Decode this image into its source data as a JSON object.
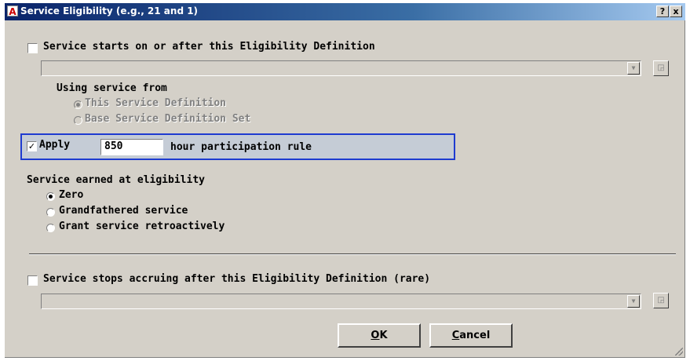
{
  "window": {
    "title": "Service Eligibility (e.g., 21 and 1)",
    "help_btn": "?",
    "close_btn": "x"
  },
  "service_start": {
    "label": "Service starts on or after this Eligibility Definition",
    "checked": false,
    "combo_value": "",
    "using_label": "Using service from",
    "radios": [
      {
        "label": "This Service Definition",
        "selected": true
      },
      {
        "label": "Base Service Definition Set",
        "selected": false
      }
    ]
  },
  "apply": {
    "checked": true,
    "check_mark": "✓",
    "label": "Apply",
    "hours_value": "850",
    "suffix": "hour participation rule"
  },
  "service_earned": {
    "label": "Service earned at eligibility",
    "options": [
      {
        "label": "Zero",
        "selected": true
      },
      {
        "label": "Grandfathered service",
        "selected": false
      },
      {
        "label": "Grant service retroactively",
        "selected": false
      }
    ]
  },
  "service_stop": {
    "label": "Service stops accruing after this Eligibility Definition (rare)",
    "checked": false,
    "combo_value": ""
  },
  "buttons": {
    "ok_accel": "O",
    "ok_rest": "K",
    "cancel_accel": "C",
    "cancel_rest": "ancel"
  },
  "colors": {
    "title_bar": "#0a246a",
    "dialog_bg": "#d4d0c8",
    "highlight_border": "#1e3bd0"
  },
  "icons": {
    "app": "app-a-icon",
    "dropdown": "chevron-down-icon",
    "picker": "picker-icon"
  }
}
